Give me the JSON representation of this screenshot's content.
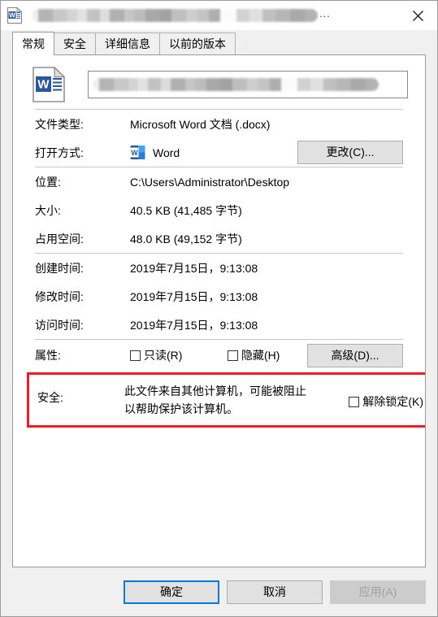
{
  "window": {
    "title_redacted": true,
    "title_ellipsis": "...",
    "close_label": "×",
    "icon": "word-document-icon"
  },
  "tabs": [
    {
      "label": "常规",
      "active": true
    },
    {
      "label": "安全",
      "active": false
    },
    {
      "label": "详细信息",
      "active": false
    },
    {
      "label": "以前的版本",
      "active": false
    }
  ],
  "file": {
    "name_redacted": true,
    "icon": "word-document-icon"
  },
  "properties": [
    {
      "label": "文件类型:",
      "value": "Microsoft Word 文档 (.docx)"
    },
    {
      "label": "位置:",
      "value": "C:\\Users\\Administrator\\Desktop"
    },
    {
      "label": "大小:",
      "value": "40.5 KB (41,485 字节)"
    },
    {
      "label": "占用空间:",
      "value": "48.0 KB (49,152 字节)"
    },
    {
      "label": "创建时间:",
      "value": "2019年7月15日，9:13:08"
    },
    {
      "label": "修改时间:",
      "value": "2019年7月15日，9:13:08"
    },
    {
      "label": "访问时间:",
      "value": "2019年7月15日，9:13:08"
    }
  ],
  "open_with": {
    "label": "打开方式:",
    "app_name": "Word",
    "app_icon": "word-app-icon",
    "change_button": "更改(C)..."
  },
  "attributes": {
    "label": "属性:",
    "readonly": {
      "label": "只读(R)",
      "checked": false
    },
    "hidden": {
      "label": "隐藏(H)",
      "checked": false
    },
    "advanced_button": "高级(D)..."
  },
  "security": {
    "label": "安全:",
    "message_line1": "此文件来自其他计算机，可能被阻止",
    "message_line2": "以帮助保护该计算机。",
    "unblock": {
      "label": "解除锁定(K)",
      "checked": false
    },
    "highlight_color": "#ee1c25"
  },
  "footer": {
    "ok": "确定",
    "cancel": "取消",
    "apply": "应用(A)",
    "apply_disabled": true
  },
  "colors": {
    "accent": "#0078d7",
    "dialog_bg": "#f0f0f0",
    "panel_bg": "#ffffff",
    "button_bg": "#e1e1e1",
    "word_blue": "#2b579a"
  }
}
